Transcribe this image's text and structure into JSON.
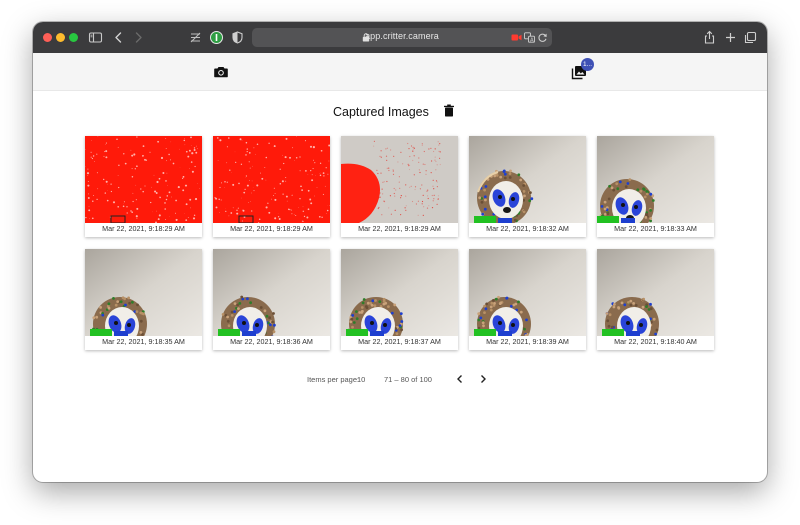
{
  "browser": {
    "url": "app.critter.camera"
  },
  "appbar": {
    "camera_icon": "camera-icon",
    "gallery_icon": "photo-library-icon",
    "gallery_badge": "1..."
  },
  "page": {
    "title": "Captured Images",
    "delete_icon": "trash-icon"
  },
  "images": [
    {
      "timestamp": "Mar 22, 2021, 9:18:29 AM",
      "variant": "red-full"
    },
    {
      "timestamp": "Mar 22, 2021, 9:18:29 AM",
      "variant": "red-full"
    },
    {
      "timestamp": "Mar 22, 2021, 9:18:29 AM",
      "variant": "red-partial"
    },
    {
      "timestamp": "Mar 22, 2021, 9:18:32 AM",
      "variant": "sloth-high"
    },
    {
      "timestamp": "Mar 22, 2021, 9:18:33 AM",
      "variant": "sloth-mid"
    },
    {
      "timestamp": "Mar 22, 2021, 9:18:35 AM",
      "variant": "sloth-low"
    },
    {
      "timestamp": "Mar 22, 2021, 9:18:36 AM",
      "variant": "sloth-low"
    },
    {
      "timestamp": "Mar 22, 2021, 9:18:37 AM",
      "variant": "sloth-low"
    },
    {
      "timestamp": "Mar 22, 2021, 9:18:39 AM",
      "variant": "sloth-low"
    },
    {
      "timestamp": "Mar 22, 2021, 9:18:40 AM",
      "variant": "sloth-low"
    }
  ],
  "paginator": {
    "items_per_page_label": "Items per page:",
    "items_per_page_value": "10",
    "range_label": "71 – 80 of 100",
    "prev_icon": "chevron-left-icon",
    "next_icon": "chevron-right-icon"
  }
}
